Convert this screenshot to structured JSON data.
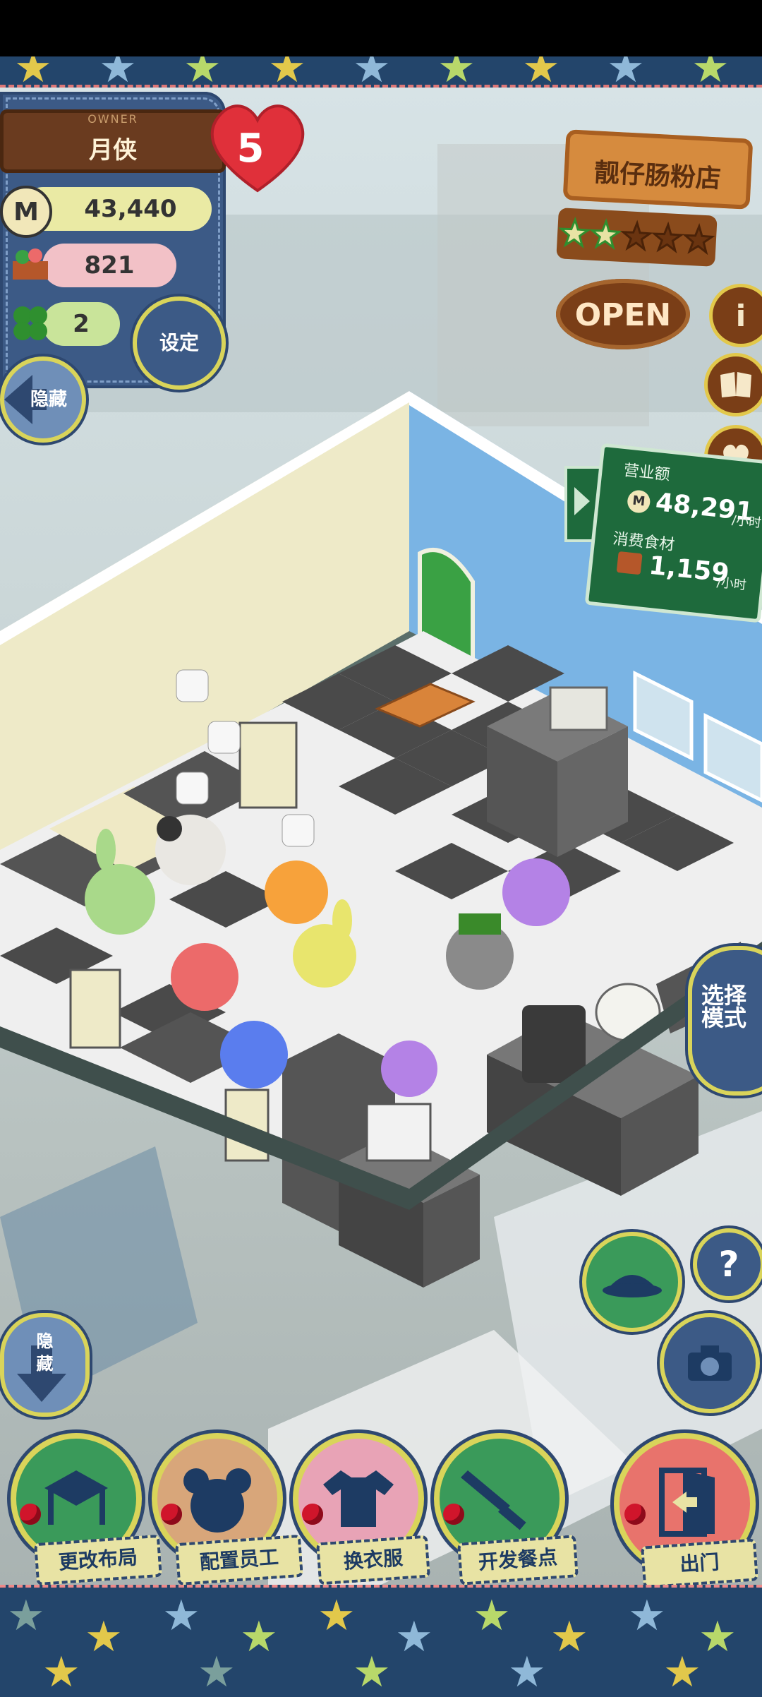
{
  "owner": {
    "header_small": "OWNER",
    "name": "月侠",
    "level": "5"
  },
  "stats": {
    "money": "43,440",
    "food": "821",
    "clover": "2"
  },
  "buttons": {
    "settings": "设定",
    "hide_top": "隐藏",
    "hide_bottom": "隐\n藏",
    "select_mode": "选择\n模式",
    "help": "?"
  },
  "shop": {
    "name": "靓仔肠粉店",
    "open_sign": "OPEN",
    "stars_filled": 2,
    "stars_total": 5
  },
  "revenue": {
    "revenue_label": "营业额",
    "revenue_value": "48,291",
    "revenue_unit": "/小时",
    "food_label": "消费食材",
    "food_value": "1,159",
    "food_unit": "/小时"
  },
  "bottom_menu": [
    {
      "label": "更改布局",
      "icon": "table-icon"
    },
    {
      "label": "配置员工",
      "icon": "bear-head-icon"
    },
    {
      "label": "换衣服",
      "icon": "shirt-icon"
    },
    {
      "label": "开发餐点",
      "icon": "knife-icon"
    },
    {
      "label": "出门",
      "icon": "door-exit-icon"
    }
  ],
  "colors": {
    "denim": "#3c5a86",
    "accent_yellow": "#d9d45a",
    "sign_wood": "#d68b3e",
    "board_green": "#1e6a3c",
    "heart_red": "#e0303a"
  }
}
